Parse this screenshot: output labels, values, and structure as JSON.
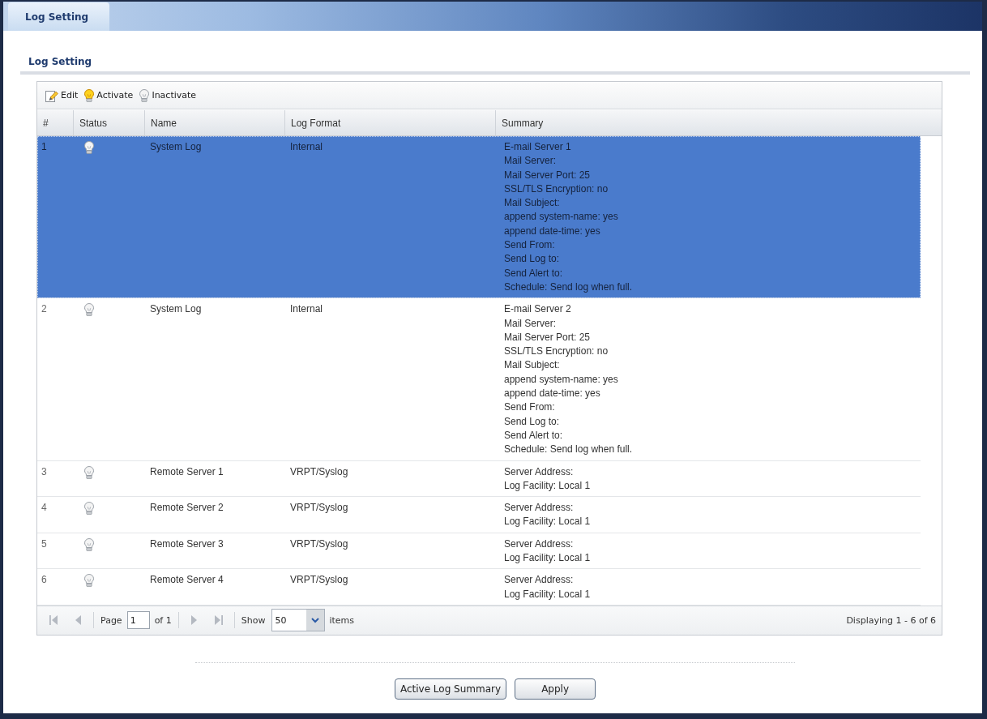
{
  "tabs": [
    {
      "label": "Log Setting",
      "selected": true
    }
  ],
  "section_title": "Log Setting",
  "toolbar": [
    {
      "kind": "edit",
      "label": "Edit"
    },
    {
      "kind": "activate",
      "label": "Activate"
    },
    {
      "kind": "inactivate",
      "label": "Inactivate"
    }
  ],
  "table": {
    "columns": [
      "#",
      "Status",
      "Name",
      "Log Format",
      "Summary"
    ],
    "rows": [
      {
        "number": "1",
        "active": false,
        "name": "System Log",
        "log_format": "Internal",
        "summary": [
          "E-mail Server 1",
          "Mail Server:",
          "Mail Server Port: 25",
          "SSL/TLS Encryption: no",
          "Mail Subject:",
          "append system-name: yes",
          "append date-time: yes",
          "Send From:",
          "Send Log to:",
          "Send Alert to:",
          "Schedule: Send log when full."
        ],
        "selected": true
      },
      {
        "number": "2",
        "active": false,
        "name": "System Log",
        "log_format": "Internal",
        "summary": [
          "E-mail Server 2",
          "Mail Server:",
          "Mail Server Port: 25",
          "SSL/TLS Encryption: no",
          "Mail Subject:",
          "append system-name: yes",
          "append date-time: yes",
          "Send From:",
          "Send Log to:",
          "Send Alert to:",
          "Schedule: Send log when full."
        ],
        "selected": false
      },
      {
        "number": "3",
        "active": false,
        "name": "Remote Server 1",
        "log_format": "VRPT/Syslog",
        "summary": [
          "Server Address:",
          "Log Facility: Local 1"
        ],
        "selected": false
      },
      {
        "number": "4",
        "active": false,
        "name": "Remote Server 2",
        "log_format": "VRPT/Syslog",
        "summary": [
          "Server Address:",
          "Log Facility: Local 1"
        ],
        "selected": false
      },
      {
        "number": "5",
        "active": false,
        "name": "Remote Server 3",
        "log_format": "VRPT/Syslog",
        "summary": [
          "Server Address:",
          "Log Facility: Local 1"
        ],
        "selected": false
      },
      {
        "number": "6",
        "active": false,
        "name": "Remote Server 4",
        "log_format": "VRPT/Syslog",
        "summary": [
          "Server Address:",
          "Log Facility: Local 1"
        ],
        "selected": false
      }
    ]
  },
  "pager": {
    "nav": [
      {
        "kind": "first",
        "disabled": true
      },
      {
        "kind": "previous",
        "disabled": true
      },
      {
        "kind": "next",
        "disabled": true
      },
      {
        "kind": "last",
        "disabled": true
      }
    ],
    "page_label": "Page",
    "page": "1",
    "page_count": "of 1",
    "show_label": "Show",
    "page_size": "50",
    "items_label": "items",
    "displaying": "Displaying 1 - 6 of 6"
  },
  "buttons": [
    "Active Log Summary",
    "Apply"
  ]
}
